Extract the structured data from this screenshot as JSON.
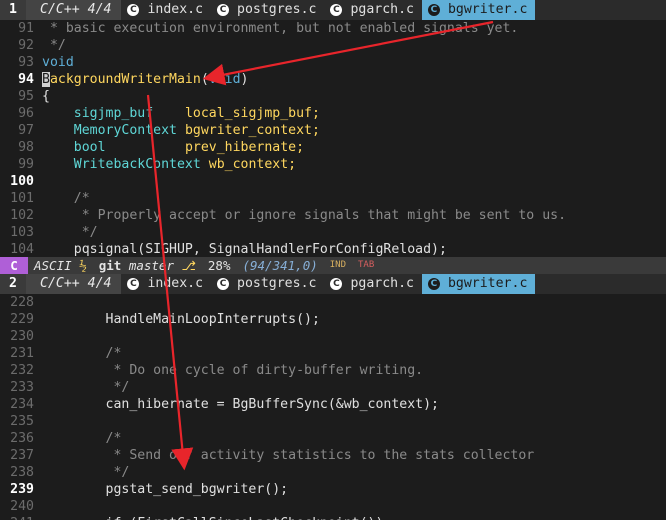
{
  "top_pane": {
    "tab_number": "1",
    "mode_label": "C/C++ 4/4",
    "tabs": [
      {
        "label": "index.c",
        "active": false
      },
      {
        "label": "postgres.c",
        "active": false
      },
      {
        "label": "pgarch.c",
        "active": false
      },
      {
        "label": "bgwriter.c",
        "active": true
      }
    ],
    "lines": [
      {
        "num": "91",
        "text": " * basic execution environment, but not enabled signals yet.",
        "kind": "comment"
      },
      {
        "num": "92",
        "text": " */",
        "kind": "comment"
      },
      {
        "num": "93",
        "text": "void",
        "kind": "keyword"
      },
      {
        "num": "94",
        "text": "BackgroundWriterMain(void)",
        "kind": "funcdef",
        "current": true
      },
      {
        "num": "95",
        "text": "{",
        "kind": "plain"
      },
      {
        "num": "96",
        "text": "    sigjmp_buf    local_sigjmp_buf;",
        "kind": "decl",
        "type": "sigjmp_buf",
        "ident": "local_sigjmp_buf;"
      },
      {
        "num": "97",
        "text": "    MemoryContext bgwriter_context;",
        "kind": "decl",
        "type": "MemoryContext",
        "ident": "bgwriter_context;"
      },
      {
        "num": "98",
        "text": "    bool          prev_hibernate;",
        "kind": "decl",
        "type": "bool",
        "ident": "prev_hibernate;"
      },
      {
        "num": "99",
        "text": "    WritebackContext wb_context;",
        "kind": "decl",
        "type": "WritebackContext",
        "ident": "wb_context;"
      },
      {
        "num": "100",
        "text": "",
        "kind": "plain",
        "current": true
      },
      {
        "num": "101",
        "text": "    /*",
        "kind": "comment"
      },
      {
        "num": "102",
        "text": "     * Properly accept or ignore signals that might be sent to us.",
        "kind": "comment"
      },
      {
        "num": "103",
        "text": "     */",
        "kind": "comment"
      },
      {
        "num": "104",
        "text": "    pqsignal(SIGHUP, SignalHandlerForConfigReload);",
        "kind": "plain"
      }
    ]
  },
  "statusline": {
    "mode": "C",
    "encoding": "ASCII",
    "encoding_icon": "½",
    "vcs": "git",
    "branch": "master",
    "branch_icon": "⎇",
    "percent": "28%",
    "position": "(94/341,0)",
    "ind": "IND",
    "tab": "TAB"
  },
  "bottom_pane": {
    "tab_number": "2",
    "mode_label": "C/C++ 4/4",
    "tabs": [
      {
        "label": "index.c",
        "active": false
      },
      {
        "label": "postgres.c",
        "active": false
      },
      {
        "label": "pgarch.c",
        "active": false
      },
      {
        "label": "bgwriter.c",
        "active": true
      }
    ],
    "lines": [
      {
        "num": "228",
        "text": "",
        "kind": "plain"
      },
      {
        "num": "229",
        "text": "        HandleMainLoopInterrupts();",
        "kind": "plain"
      },
      {
        "num": "230",
        "text": "",
        "kind": "plain"
      },
      {
        "num": "231",
        "text": "        /*",
        "kind": "comment"
      },
      {
        "num": "232",
        "text": "         * Do one cycle of dirty-buffer writing.",
        "kind": "comment"
      },
      {
        "num": "233",
        "text": "         */",
        "kind": "comment"
      },
      {
        "num": "234",
        "text": "        can_hibernate = BgBufferSync(&wb_context);",
        "kind": "plain"
      },
      {
        "num": "235",
        "text": "",
        "kind": "plain"
      },
      {
        "num": "236",
        "text": "        /*",
        "kind": "comment"
      },
      {
        "num": "237",
        "text": "         * Send off activity statistics to the stats collector",
        "kind": "comment"
      },
      {
        "num": "238",
        "text": "         */",
        "kind": "comment"
      },
      {
        "num": "239",
        "text": "        pgstat_send_bgwriter();",
        "kind": "plain",
        "current": true
      },
      {
        "num": "240",
        "text": "",
        "kind": "plain"
      },
      {
        "num": "241",
        "text": "        if (FirstCallSinceLastCheckpoint())",
        "kind": "plain"
      }
    ]
  },
  "colors": {
    "arrow": "#e8252b",
    "active_tab": "#5fafd7",
    "mode_badge": "#af5fd7"
  },
  "icons": {
    "tab_file": "c-language-icon",
    "arrows": [
      "annotation-arrow-to-tab",
      "annotation-arrow-down"
    ]
  }
}
